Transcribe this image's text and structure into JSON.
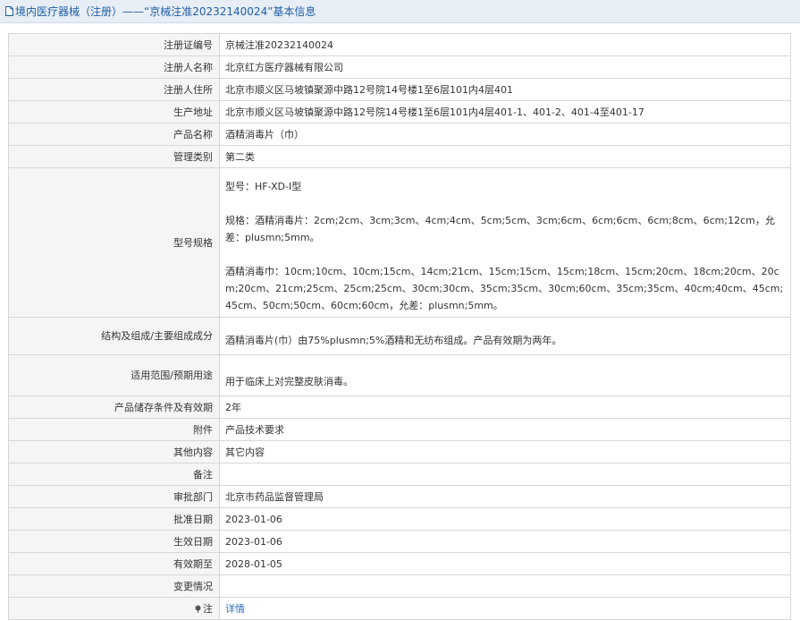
{
  "page": {
    "title": "境内医疗器械（注册）——“京械注准20232140024”基本信息",
    "title_icon": "document-icon",
    "accent_color": "#1e5ea8"
  },
  "record": {
    "reg_no": {
      "label": "注册证编号",
      "value": "京械注准20232140024"
    },
    "registrant": {
      "label": "注册人名称",
      "value": "北京红方医疗器械有限公司"
    },
    "registrant_address": {
      "label": "注册人住所",
      "value": "北京市顺义区马坡镇聚源中路12号院14号楼1至6层101内4层401"
    },
    "production_address": {
      "label": "生产地址",
      "value": "北京市顺义区马坡镇聚源中路12号院14号楼1至6层101内4层401-1、401-2、401-4至401-17"
    },
    "product_name": {
      "label": "产品名称",
      "value": "酒精消毒片（巾）"
    },
    "category": {
      "label": "管理类别",
      "value": "第二类"
    },
    "model_spec": {
      "label": "型号规格",
      "model": "型号：HF-XD-I型",
      "spec_tablet": "规格：酒精消毒片：2cm;2cm、3cm;3cm、4cm;4cm、5cm;5cm、3cm;6cm、6cm;6cm、6cm;8cm、6cm;12cm，允差：plusmn;5mm。",
      "spec_towel": "酒精消毒巾：10cm;10cm、10cm;15cm、14cm;21cm、15cm;15cm、15cm;18cm、15cm;20cm、18cm;20cm、20cm;20cm、21cm;25cm、25cm;25cm、30cm;30cm、35cm;35cm、30cm;60cm、35cm;35cm、40cm;40cm、45cm;45cm、50cm;50cm、60cm;60cm，允差：plusmn;5mm。"
    },
    "composition": {
      "label": "结构及组成/主要组成成分",
      "value": "酒精消毒片(巾）由75%plusmn;5%酒精和无纺布组成。产品有效期为两年。"
    },
    "intended_use": {
      "label": "适用范围/预期用途",
      "value": "用于临床上对完整皮肤消毒。"
    },
    "storage": {
      "label": "产品储存条件及有效期",
      "value": "2年"
    },
    "attachment": {
      "label": "附件",
      "value": "产品技术要求"
    },
    "other": {
      "label": "其他内容",
      "value": "其它内容"
    },
    "remarks": {
      "label": "备注",
      "value": ""
    },
    "approval_dept": {
      "label": "审批部门",
      "value": "北京市药品监督管理局"
    },
    "approval_date": {
      "label": "批准日期",
      "value": "2023-01-06"
    },
    "effective_date": {
      "label": "生效日期",
      "value": "2023-01-06"
    },
    "expiry_date": {
      "label": "有效期至",
      "value": "2028-01-05"
    },
    "changes": {
      "label": "变更情况",
      "value": ""
    },
    "note": {
      "label": "注",
      "icon": "pin-icon",
      "link_text": "详情",
      "link_color": "#2b6cc4"
    }
  }
}
